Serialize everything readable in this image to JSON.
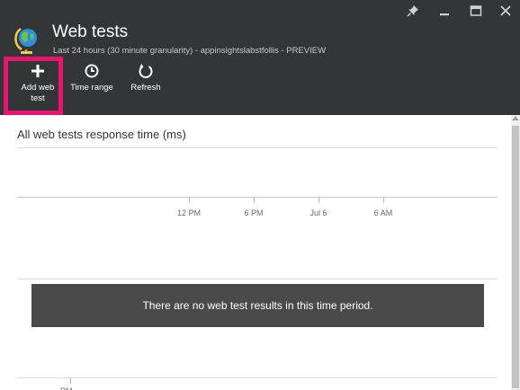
{
  "header": {
    "title": "Web tests",
    "subtitle": "Last 24 hours (30 minute granularity) - appinsightslabstfollis - PREVIEW",
    "icon": "globe-icon",
    "window_controls": [
      "pin-icon",
      "minimize-icon",
      "maximize-icon",
      "close-icon"
    ]
  },
  "commands": {
    "add_web_test": {
      "line1": "Add web",
      "line2": "test",
      "icon": "plus-icon"
    },
    "time_range": {
      "label": "Time range",
      "icon": "clock-icon"
    },
    "refresh": {
      "label": "Refresh",
      "icon": "refresh-icon"
    }
  },
  "chart": {
    "title": "All web tests response time (ms)",
    "x_ticks": [
      "12 PM",
      "6 PM",
      "Jul 6",
      "6 AM"
    ],
    "cut_off_label": "PM",
    "empty_message": "There are no web test results in this time period."
  },
  "colors": {
    "header_bg": "#323637",
    "highlight": "#e8156f",
    "message_bg": "#4a4a4a"
  }
}
